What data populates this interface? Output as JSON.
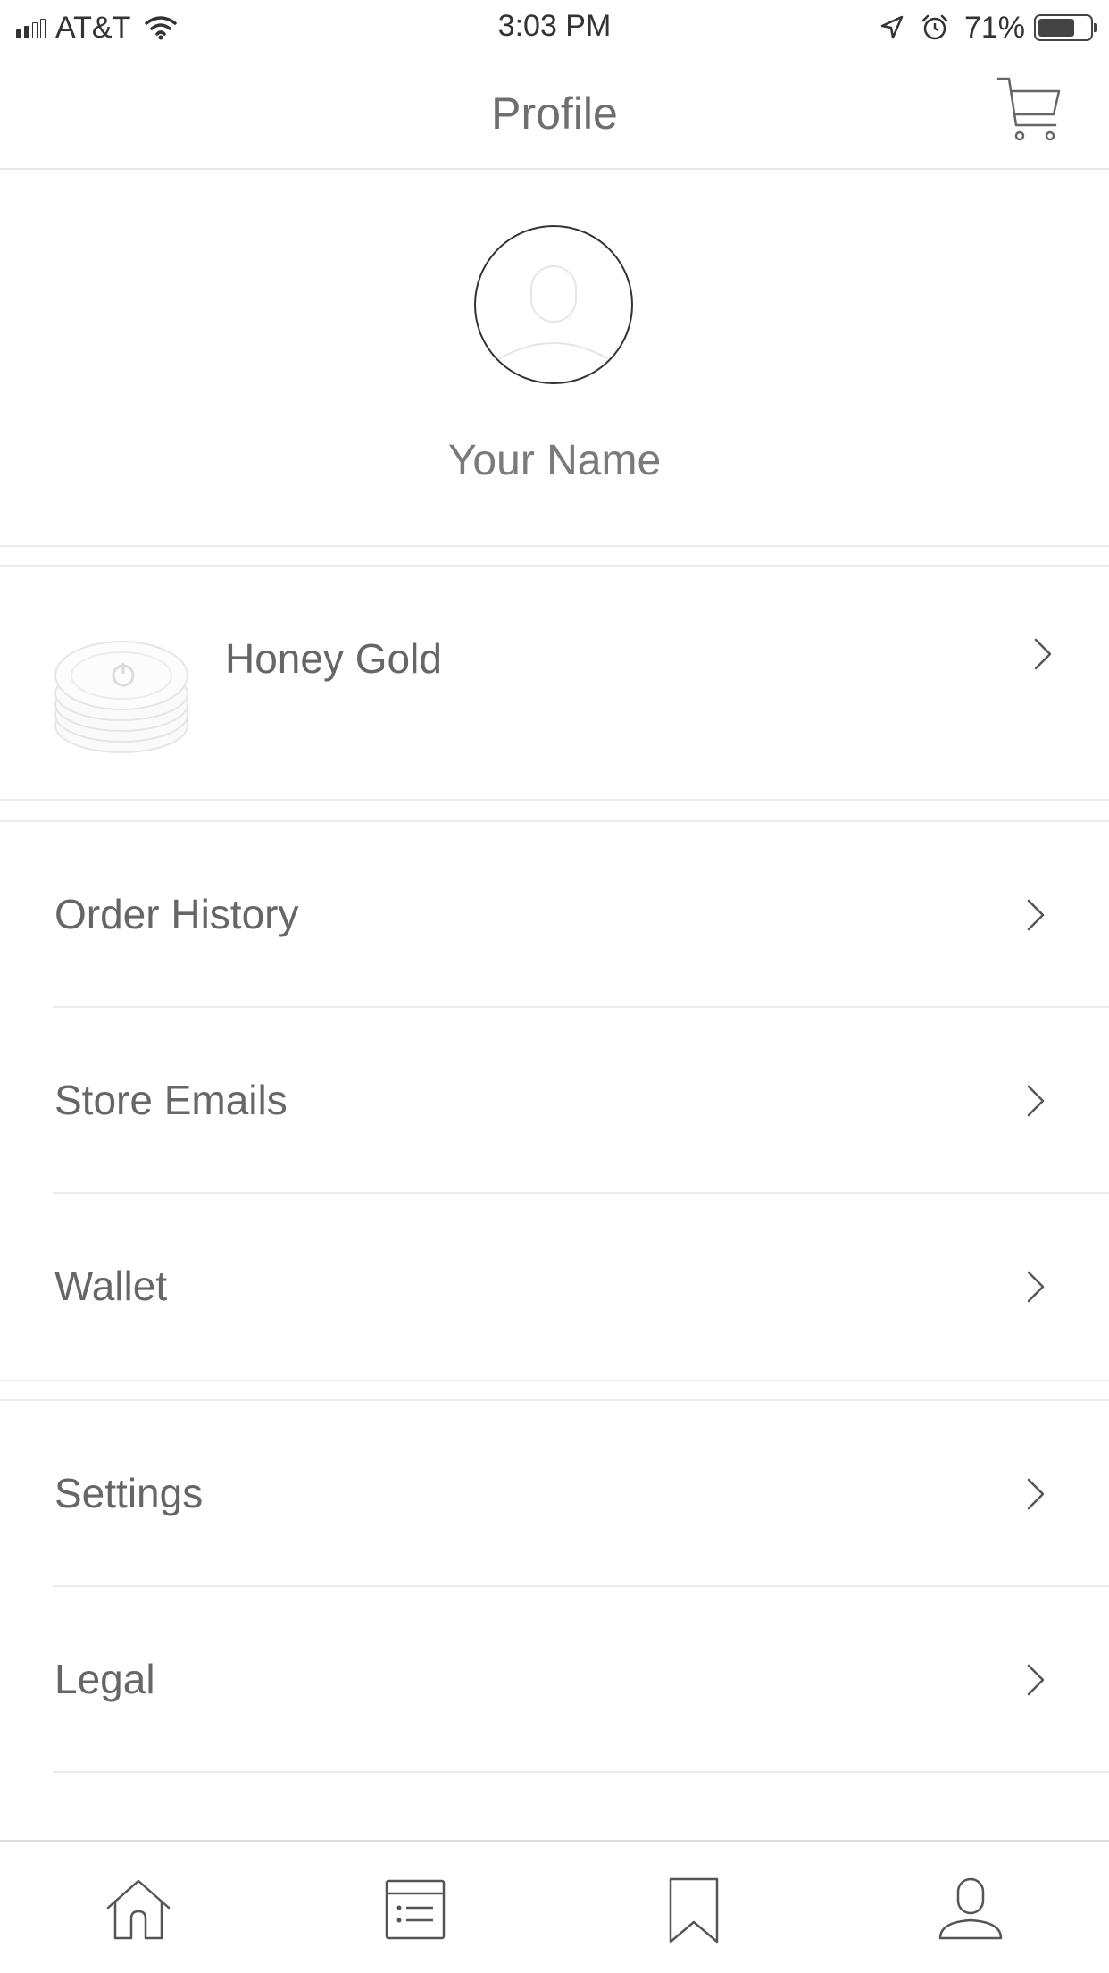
{
  "status_bar": {
    "carrier": "AT&T",
    "time": "3:03 PM",
    "battery_percent": "71%",
    "battery_level": 0.71,
    "signal_bars": 2,
    "icons": [
      "signal-icon",
      "wifi-icon",
      "location-arrow-icon",
      "alarm-icon",
      "battery-icon"
    ]
  },
  "header": {
    "title": "Profile",
    "right_icon": "cart-icon"
  },
  "profile": {
    "name": "Your Name",
    "avatar_icon": "avatar-placeholder-icon"
  },
  "honey_gold": {
    "label": "Honey Gold",
    "icon": "honey-gold-coins-icon"
  },
  "menu": {
    "group1": [
      {
        "label": "Order History",
        "icon": "chevron-right-icon"
      },
      {
        "label": "Store Emails",
        "icon": "chevron-right-icon"
      },
      {
        "label": "Wallet",
        "icon": "chevron-right-icon"
      }
    ],
    "group2": [
      {
        "label": "Settings",
        "icon": "chevron-right-icon"
      },
      {
        "label": "Legal",
        "icon": "chevron-right-icon"
      }
    ]
  },
  "tab_bar": {
    "tabs": [
      {
        "icon": "home-icon"
      },
      {
        "icon": "list-icon"
      },
      {
        "icon": "bookmark-icon"
      },
      {
        "icon": "profile-icon",
        "selected": true
      }
    ]
  },
  "colors": {
    "text": "#666666",
    "divider": "#ececec",
    "background": "#ffffff",
    "icon_stroke": "#555555"
  }
}
